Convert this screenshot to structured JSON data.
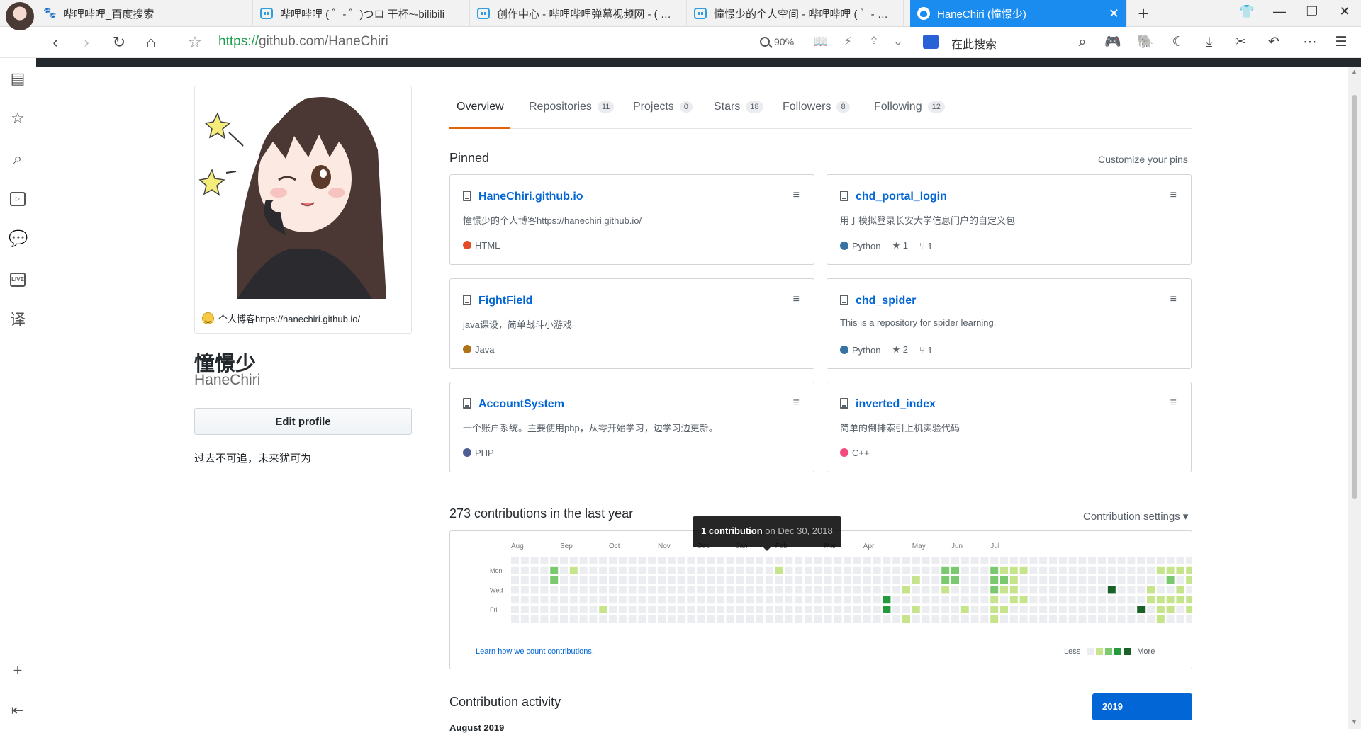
{
  "browser": {
    "tabs": [
      {
        "title": "哔哩哔哩_百度搜索",
        "icon": "baidu-paw-icon",
        "active": false
      },
      {
        "title": "哔哩哔哩 ( ゜- ゜)つロ 干杯~-bilibili",
        "icon": "bilibili-tv-icon",
        "active": false
      },
      {
        "title": "创作中心 - 哔哩哔哩弹幕视频网 - ( ゜- ゜)つロ 乾杯~",
        "icon": "bilibili-tv-icon",
        "active": false
      },
      {
        "title": "憧憬少的个人空间 - 哔哩哔哩 ( ゜- ゜)つロ 乾杯~",
        "icon": "bilibili-tv-icon",
        "active": false
      },
      {
        "title": "HaneChiri (憧憬少)",
        "icon": "github-icon",
        "active": true
      }
    ],
    "new_tab": "+",
    "url": {
      "scheme": "https://",
      "rest": "github.com/HaneChiri"
    },
    "zoom": "90%",
    "search_placeholder": "在此搜索",
    "accent": "#1a8cf0"
  },
  "profile": {
    "status": "个人博客https://hanechiri.github.io/",
    "name": "憧憬少",
    "login": "HaneChiri",
    "edit_button": "Edit profile",
    "bio": "过去不可追，未来犹可为"
  },
  "profile_nav": [
    {
      "label": "Overview",
      "count": null,
      "selected": true
    },
    {
      "label": "Repositories",
      "count": "11",
      "selected": false
    },
    {
      "label": "Projects",
      "count": "0",
      "selected": false
    },
    {
      "label": "Stars",
      "count": "18",
      "selected": false
    },
    {
      "label": "Followers",
      "count": "8",
      "selected": false
    },
    {
      "label": "Following",
      "count": "12",
      "selected": false
    }
  ],
  "pinned": {
    "title": "Pinned",
    "customize": "Customize your pins",
    "repos": [
      {
        "name": "HaneChiri.github.io",
        "description": "憧憬少的个人博客https://hanechiri.github.io/",
        "language": "HTML",
        "color": "#e34c26",
        "stars": null,
        "forks": null
      },
      {
        "name": "chd_portal_login",
        "description": "用于模拟登录长安大学信息门户的自定义包",
        "language": "Python",
        "color": "#3572a5",
        "stars": "1",
        "forks": "1"
      },
      {
        "name": "FightField",
        "description": "java课设，简单战斗小游戏",
        "language": "Java",
        "color": "#b07219",
        "stars": null,
        "forks": null
      },
      {
        "name": "chd_spider",
        "description": "This is a repository for spider learning.",
        "language": "Python",
        "color": "#3572a5",
        "stars": "2",
        "forks": "1"
      },
      {
        "name": "AccountSystem",
        "description": "一个账户系统。主要使用php，从零开始学习，边学习边更新。",
        "language": "PHP",
        "color": "#4f5d95",
        "stars": null,
        "forks": null
      },
      {
        "name": "inverted_index",
        "description": "简单的倒排索引上机实验代码",
        "language": "C++",
        "color": "#f34b7d",
        "stars": null,
        "forks": null
      }
    ]
  },
  "contributions": {
    "title": "273 contributions in the last year",
    "settings": "Contribution settings",
    "months": [
      "Aug",
      "Sep",
      "Oct",
      "Nov",
      "Dec",
      "Jan",
      "Feb",
      "Mar",
      "Apr",
      "May",
      "Jun",
      "Jul"
    ],
    "days": [
      "Mon",
      "Wed",
      "Fri"
    ],
    "learn_link": "Learn how we count contributions.",
    "legend_less": "Less",
    "legend_more": "More",
    "colors": [
      "#ebedf0",
      "#c6e48b",
      "#7bc96f",
      "#239a3b",
      "#196127"
    ],
    "tooltip_count": "1 contribution",
    "tooltip_date": "on Dec 30, 2018",
    "grid": [
      "0000000",
      "0000000",
      "0000000",
      "0000000",
      "0220000",
      "0000000",
      "0100000",
      "0000000",
      "0000000",
      "0000010",
      "0000000",
      "0000000",
      "0000000",
      "0000000",
      "0000000",
      "0000000",
      "0000000",
      "0000000",
      "0000000",
      "0000000",
      "0000000",
      "0000000",
      "0000000",
      "0000000",
      "0000000",
      "0000000",
      "0000000",
      "0100000",
      "0000000",
      "0000000",
      "0000000",
      "0000000",
      "0000000",
      "0000000",
      "0000000",
      "0000000",
      "0000000",
      "0000000",
      "0000330",
      "0000000",
      "0001001",
      "0010010",
      "0000000",
      "0000000",
      "0221000",
      "0220000",
      "0000010",
      "0000000",
      "0000000",
      "0222111",
      "0121010",
      "0111100",
      "0100100",
      "0000000",
      "0000000",
      "0000000",
      "0000000",
      "0000000",
      "0000000",
      "0000000",
      "0000000",
      "0004000",
      "0000000",
      "0000000",
      "0000040",
      "0001100",
      "0100111",
      "0120110",
      "0101100",
      "0110110",
      "0101100"
    ]
  },
  "activity": {
    "title": "Contribution activity",
    "year": "2019",
    "month": "August 2019"
  }
}
